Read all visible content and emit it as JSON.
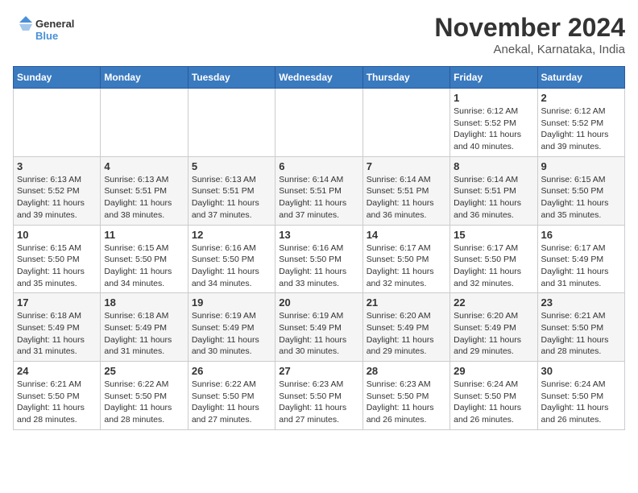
{
  "logo": {
    "line1": "General",
    "line2": "Blue"
  },
  "title": "November 2024",
  "location": "Anekal, Karnataka, India",
  "weekdays": [
    "Sunday",
    "Monday",
    "Tuesday",
    "Wednesday",
    "Thursday",
    "Friday",
    "Saturday"
  ],
  "weeks": [
    [
      {
        "day": "",
        "info": ""
      },
      {
        "day": "",
        "info": ""
      },
      {
        "day": "",
        "info": ""
      },
      {
        "day": "",
        "info": ""
      },
      {
        "day": "",
        "info": ""
      },
      {
        "day": "1",
        "info": "Sunrise: 6:12 AM\nSunset: 5:52 PM\nDaylight: 11 hours and 40 minutes."
      },
      {
        "day": "2",
        "info": "Sunrise: 6:12 AM\nSunset: 5:52 PM\nDaylight: 11 hours and 39 minutes."
      }
    ],
    [
      {
        "day": "3",
        "info": "Sunrise: 6:13 AM\nSunset: 5:52 PM\nDaylight: 11 hours and 39 minutes."
      },
      {
        "day": "4",
        "info": "Sunrise: 6:13 AM\nSunset: 5:51 PM\nDaylight: 11 hours and 38 minutes."
      },
      {
        "day": "5",
        "info": "Sunrise: 6:13 AM\nSunset: 5:51 PM\nDaylight: 11 hours and 37 minutes."
      },
      {
        "day": "6",
        "info": "Sunrise: 6:14 AM\nSunset: 5:51 PM\nDaylight: 11 hours and 37 minutes."
      },
      {
        "day": "7",
        "info": "Sunrise: 6:14 AM\nSunset: 5:51 PM\nDaylight: 11 hours and 36 minutes."
      },
      {
        "day": "8",
        "info": "Sunrise: 6:14 AM\nSunset: 5:51 PM\nDaylight: 11 hours and 36 minutes."
      },
      {
        "day": "9",
        "info": "Sunrise: 6:15 AM\nSunset: 5:50 PM\nDaylight: 11 hours and 35 minutes."
      }
    ],
    [
      {
        "day": "10",
        "info": "Sunrise: 6:15 AM\nSunset: 5:50 PM\nDaylight: 11 hours and 35 minutes."
      },
      {
        "day": "11",
        "info": "Sunrise: 6:15 AM\nSunset: 5:50 PM\nDaylight: 11 hours and 34 minutes."
      },
      {
        "day": "12",
        "info": "Sunrise: 6:16 AM\nSunset: 5:50 PM\nDaylight: 11 hours and 34 minutes."
      },
      {
        "day": "13",
        "info": "Sunrise: 6:16 AM\nSunset: 5:50 PM\nDaylight: 11 hours and 33 minutes."
      },
      {
        "day": "14",
        "info": "Sunrise: 6:17 AM\nSunset: 5:50 PM\nDaylight: 11 hours and 32 minutes."
      },
      {
        "day": "15",
        "info": "Sunrise: 6:17 AM\nSunset: 5:50 PM\nDaylight: 11 hours and 32 minutes."
      },
      {
        "day": "16",
        "info": "Sunrise: 6:17 AM\nSunset: 5:49 PM\nDaylight: 11 hours and 31 minutes."
      }
    ],
    [
      {
        "day": "17",
        "info": "Sunrise: 6:18 AM\nSunset: 5:49 PM\nDaylight: 11 hours and 31 minutes."
      },
      {
        "day": "18",
        "info": "Sunrise: 6:18 AM\nSunset: 5:49 PM\nDaylight: 11 hours and 31 minutes."
      },
      {
        "day": "19",
        "info": "Sunrise: 6:19 AM\nSunset: 5:49 PM\nDaylight: 11 hours and 30 minutes."
      },
      {
        "day": "20",
        "info": "Sunrise: 6:19 AM\nSunset: 5:49 PM\nDaylight: 11 hours and 30 minutes."
      },
      {
        "day": "21",
        "info": "Sunrise: 6:20 AM\nSunset: 5:49 PM\nDaylight: 11 hours and 29 minutes."
      },
      {
        "day": "22",
        "info": "Sunrise: 6:20 AM\nSunset: 5:49 PM\nDaylight: 11 hours and 29 minutes."
      },
      {
        "day": "23",
        "info": "Sunrise: 6:21 AM\nSunset: 5:50 PM\nDaylight: 11 hours and 28 minutes."
      }
    ],
    [
      {
        "day": "24",
        "info": "Sunrise: 6:21 AM\nSunset: 5:50 PM\nDaylight: 11 hours and 28 minutes."
      },
      {
        "day": "25",
        "info": "Sunrise: 6:22 AM\nSunset: 5:50 PM\nDaylight: 11 hours and 28 minutes."
      },
      {
        "day": "26",
        "info": "Sunrise: 6:22 AM\nSunset: 5:50 PM\nDaylight: 11 hours and 27 minutes."
      },
      {
        "day": "27",
        "info": "Sunrise: 6:23 AM\nSunset: 5:50 PM\nDaylight: 11 hours and 27 minutes."
      },
      {
        "day": "28",
        "info": "Sunrise: 6:23 AM\nSunset: 5:50 PM\nDaylight: 11 hours and 26 minutes."
      },
      {
        "day": "29",
        "info": "Sunrise: 6:24 AM\nSunset: 5:50 PM\nDaylight: 11 hours and 26 minutes."
      },
      {
        "day": "30",
        "info": "Sunrise: 6:24 AM\nSunset: 5:50 PM\nDaylight: 11 hours and 26 minutes."
      }
    ]
  ]
}
